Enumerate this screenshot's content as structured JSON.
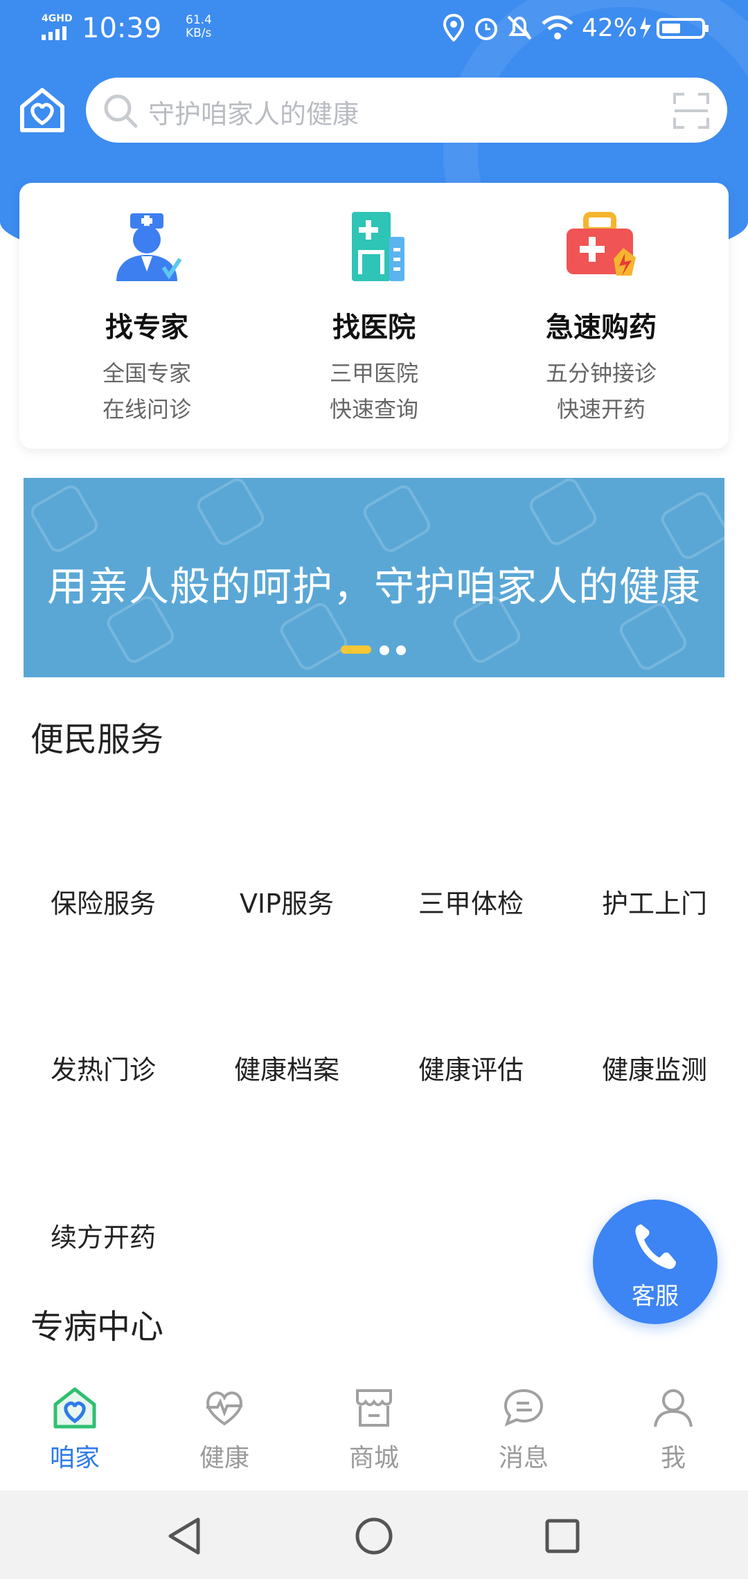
{
  "status_bar": {
    "network": "4GHD",
    "time": "10:39",
    "speed_value": "61.4",
    "speed_unit": "KB/s",
    "battery": "42%"
  },
  "search": {
    "placeholder": "守护咱家人的健康"
  },
  "quick_actions": [
    {
      "title": "找专家",
      "line1": "全国专家",
      "line2": "在线问诊",
      "icon": "doctor-icon"
    },
    {
      "title": "找医院",
      "line1": "三甲医院",
      "line2": "快速查询",
      "icon": "hospital-icon"
    },
    {
      "title": "急速购药",
      "line1": "五分钟接诊",
      "line2": "快速开药",
      "icon": "medicine-kit-icon"
    }
  ],
  "banner": {
    "text": "用亲人般的呵护，守护咱家人的健康",
    "slide_count": 3,
    "active_slide": 1
  },
  "convenience": {
    "title": "便民服务",
    "items": [
      "保险服务",
      "VIP服务",
      "三甲体检",
      "护工上门",
      "发热门诊",
      "健康档案",
      "健康评估",
      "健康监测",
      "续方开药"
    ]
  },
  "special": {
    "title": "专病中心"
  },
  "fab": {
    "label": "客服",
    "icon": "phone-icon"
  },
  "tabs": [
    {
      "label": "咱家",
      "icon": "home-heart-icon",
      "active": true
    },
    {
      "label": "健康",
      "icon": "heartbeat-icon",
      "active": false
    },
    {
      "label": "商城",
      "icon": "store-icon",
      "active": false
    },
    {
      "label": "消息",
      "icon": "message-icon",
      "active": false
    },
    {
      "label": "我",
      "icon": "user-icon",
      "active": false
    }
  ],
  "colors": {
    "primary": "#3d8cf0",
    "active_tab": "#2f7be8",
    "banner": "#5aa7d6",
    "indicator": "#f5c635"
  }
}
